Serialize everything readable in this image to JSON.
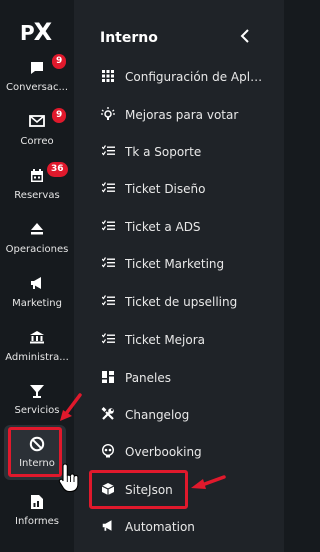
{
  "logo": {
    "text_p": "P",
    "text_x": "X"
  },
  "rail": [
    {
      "label": "Conversac...",
      "icon": "chat-icon",
      "badge": "9"
    },
    {
      "label": "Correo",
      "icon": "mail-icon",
      "badge": "9"
    },
    {
      "label": "Reservas",
      "icon": "calendar-icon",
      "badge": "36"
    },
    {
      "label": "Operaciones",
      "icon": "eject-icon",
      "badge": ""
    },
    {
      "label": "Marketing",
      "icon": "megaphone-icon",
      "badge": ""
    },
    {
      "label": "Administra...",
      "icon": "bank-icon",
      "badge": ""
    },
    {
      "label": "Servicios",
      "icon": "cocktail-icon",
      "badge": ""
    },
    {
      "label": "Interno",
      "icon": "block-icon",
      "badge": ""
    },
    {
      "label": "Informes",
      "icon": "report-icon",
      "badge": ""
    }
  ],
  "panel": {
    "title": "Interno",
    "collapse_icon": "chevron-left-icon",
    "items": [
      {
        "label": "Configuración de Aplica...",
        "icon": "grid-icon"
      },
      {
        "label": "Mejoras para votar",
        "icon": "bulb-icon"
      },
      {
        "label": "Tk a Soporte",
        "icon": "checklist-icon"
      },
      {
        "label": "Ticket Diseño",
        "icon": "checklist-icon"
      },
      {
        "label": "Ticket a ADS",
        "icon": "checklist-icon"
      },
      {
        "label": "Ticket Marketing",
        "icon": "checklist-icon"
      },
      {
        "label": "Ticket de upselling",
        "icon": "checklist-icon"
      },
      {
        "label": "Ticket Mejora",
        "icon": "checklist-icon"
      },
      {
        "label": "Paneles",
        "icon": "dashboard-icon"
      },
      {
        "label": "Changelog",
        "icon": "tools-icon"
      },
      {
        "label": "Overbooking",
        "icon": "skull-icon"
      },
      {
        "label": "SiteJson",
        "icon": "cube-icon"
      },
      {
        "label": "Automation",
        "icon": "megaphone-icon"
      }
    ]
  },
  "colors": {
    "highlight": "#e0192c",
    "rail_bg": "#161a1e",
    "panel_bg": "#1f2328"
  }
}
